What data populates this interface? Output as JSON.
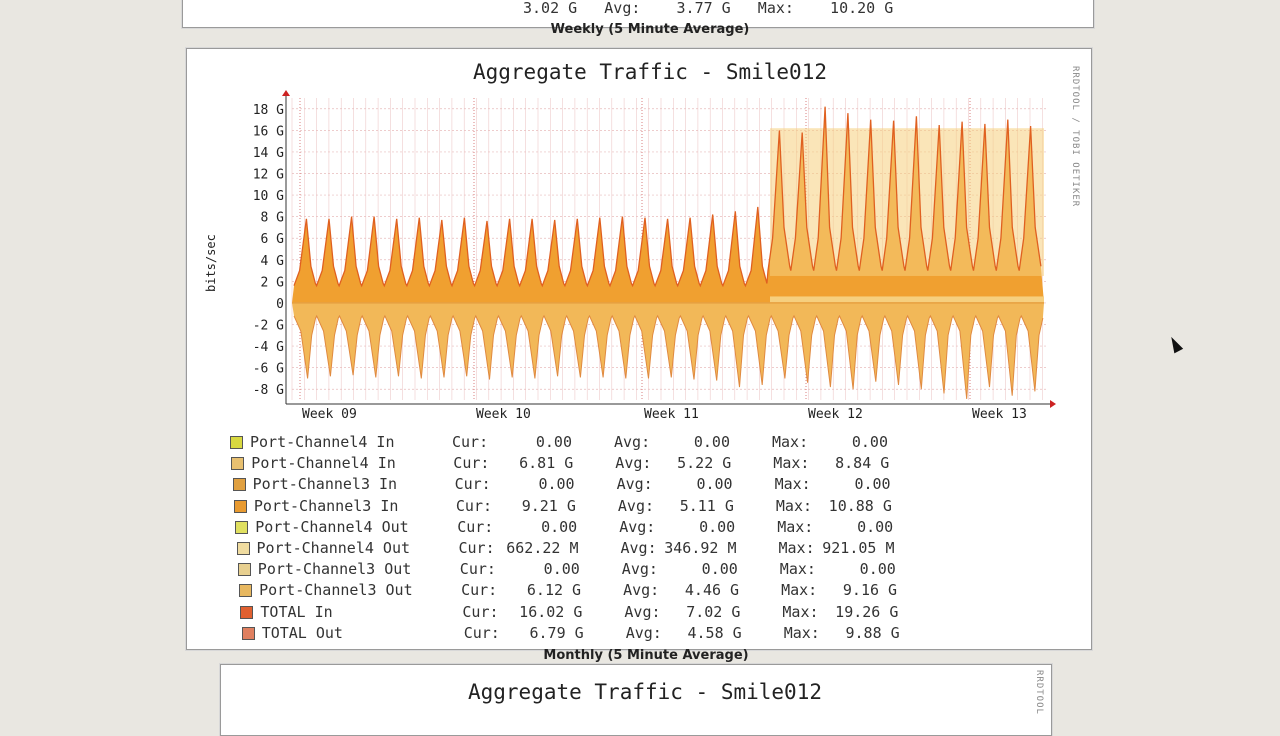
{
  "top_panel": {
    "partial_line": "3.02 G   Avg:    3.77 G   Max:    10.20 G",
    "caption": "Weekly (5 Minute Average)"
  },
  "side_text": "RRDTOOL / TOBI OETIKER",
  "chart_data": {
    "type": "area",
    "title": "Aggregate Traffic - Smile012",
    "ylabel": "bits/sec",
    "xlabel": "",
    "x_ticks": [
      "Week 09",
      "Week 10",
      "Week 11",
      "Week 12",
      "Week 13"
    ],
    "y_ticks": [
      "18 G",
      "16 G",
      "14 G",
      "12 G",
      "10 G",
      "8 G",
      "6 G",
      "4 G",
      "2 G",
      "0",
      "-2 G",
      "-4 G",
      "-6 G",
      "-8 G"
    ],
    "y_tick_values": [
      18,
      16,
      14,
      12,
      10,
      8,
      6,
      4,
      2,
      0,
      -2,
      -4,
      -6,
      -8
    ],
    "ylim": [
      -9,
      19
    ],
    "grid": true,
    "daily_peaks_in_before": [
      7.8,
      7.8,
      8.0,
      8.0,
      7.8,
      7.9,
      7.7,
      7.9,
      7.6,
      7.8,
      7.8,
      7.7,
      7.8,
      7.9,
      8.0,
      7.9,
      7.8,
      7.9,
      8.2,
      8.5,
      8.9
    ],
    "daily_peaks_in_after": [
      16.0,
      15.8,
      18.2,
      17.6,
      17.0,
      16.9,
      17.3,
      16.5,
      16.8,
      16.6,
      17.0,
      16.4
    ],
    "daily_peaks_out": [
      -7.0,
      -6.8,
      -6.7,
      -6.9,
      -6.8,
      -7.0,
      -6.9,
      -6.8,
      -7.1,
      -6.9,
      -7.0,
      -6.8,
      -6.9,
      -6.9,
      -7.0,
      -7.0,
      -6.9,
      -7.1,
      -7.2,
      -7.8,
      -7.6,
      -7.0,
      -7.4,
      -7.8,
      -8.0,
      -7.3,
      -7.6,
      -8.0,
      -8.4,
      -8.9,
      -7.8,
      -8.6,
      -8.2
    ],
    "step_index_label": "Week 12",
    "series": [
      {
        "name": "Port-Channel4 In",
        "cur": "0.00",
        "avg": "0.00",
        "max": "0.00",
        "color": "#d8d840"
      },
      {
        "name": "Port-Channel4 In",
        "cur": "6.81 G",
        "avg": "5.22 G",
        "max": "8.84 G",
        "color": "#e8c070"
      },
      {
        "name": "Port-Channel3 In",
        "cur": "0.00",
        "avg": "0.00",
        "max": "0.00",
        "color": "#e0a040"
      },
      {
        "name": "Port-Channel3 In",
        "cur": "9.21 G",
        "avg": "5.11 G",
        "max": "10.88 G",
        "color": "#e89a30"
      },
      {
        "name": "Port-Channel4 Out",
        "cur": "0.00",
        "avg": "0.00",
        "max": "0.00",
        "color": "#e0e060"
      },
      {
        "name": "Port-Channel4 Out",
        "cur": "662.22 M",
        "avg": "346.92 M",
        "max": "921.05 M",
        "color": "#f0dca0"
      },
      {
        "name": "Port-Channel3 Out",
        "cur": "0.00",
        "avg": "0.00",
        "max": "0.00",
        "color": "#e8d090"
      },
      {
        "name": "Port-Channel3 Out",
        "cur": "6.12 G",
        "avg": "4.46 G",
        "max": "9.16 G",
        "color": "#e8b860"
      },
      {
        "name": "TOTAL In",
        "cur": "16.02 G",
        "avg": "7.02 G",
        "max": "19.26 G",
        "color": "#e06030"
      },
      {
        "name": "TOTAL Out",
        "cur": "6.79 G",
        "avg": "4.58 G",
        "max": "9.88 G",
        "color": "#e08060"
      }
    ],
    "stat_labels": {
      "cur": "Cur:",
      "avg": "Avg:",
      "max": "Max:"
    },
    "colors": {
      "in_base": "#f0a030",
      "in_upper": "#f6cf7e",
      "out_area": "#f2b858",
      "total_line": "#e06020"
    }
  },
  "bottom_caption": "Monthly (5 Minute Average)",
  "next_panel": {
    "title": "Aggregate Traffic - Smile012",
    "side_text": "RRDTOOL"
  }
}
